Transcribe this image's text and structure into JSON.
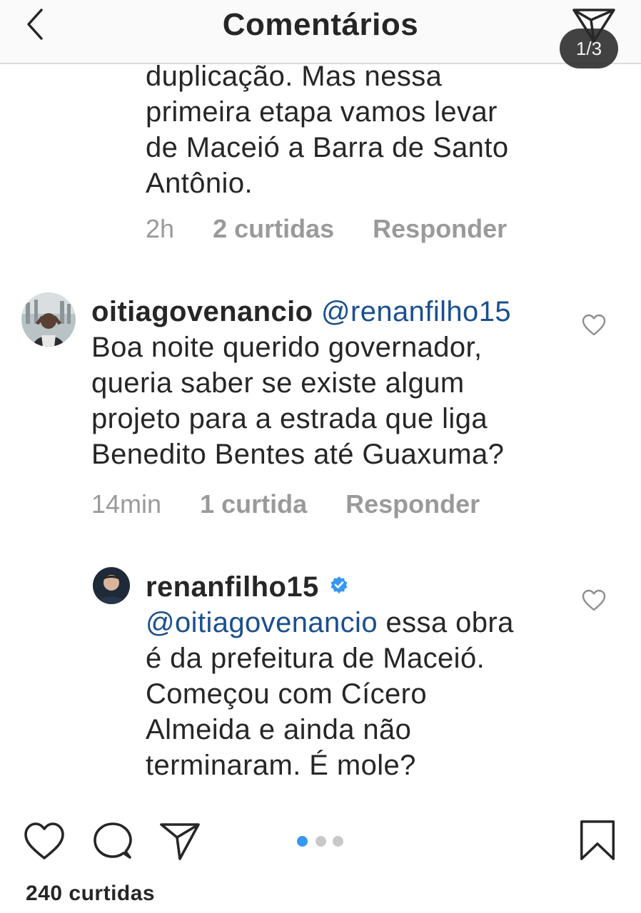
{
  "header": {
    "title": "Comentários",
    "back_icon": "chevron-left-icon",
    "direct_icon": "paper-plane-icon",
    "page_indicator": "1/3"
  },
  "comments": [
    {
      "text_lines": [
        "duplicação. Mas nessa",
        "primeira etapa vamos levar",
        "de Maceió a Barra de Santo",
        "Antônio."
      ],
      "time": "2h",
      "likes": "2 curtidas",
      "reply": "Responder"
    },
    {
      "username": "oitiagovenancio",
      "mention": "@renanfilho15",
      "text_lines": [
        "Boa noite querido governador,",
        "queria saber se existe algum",
        "projeto para a estrada que liga",
        "Benedito Bentes até Guaxuma?"
      ],
      "time": "14min",
      "likes": "1 curtida",
      "reply": "Responder"
    },
    {
      "username": "renanfilho15",
      "verified": true,
      "mention": "@oitiagovenancio",
      "text_first_suffix": " essa obra",
      "text_lines": [
        "é da prefeitura de Maceió.",
        "Começou com Cícero",
        "Almeida e ainda não",
        "terminaram. É mole?"
      ]
    }
  ],
  "actions": {
    "like_icon": "heart-icon",
    "comment_icon": "comment-bubble-icon",
    "share_icon": "paper-plane-icon",
    "save_icon": "bookmark-icon"
  },
  "carousel": {
    "total": 3,
    "active": 1
  },
  "post_likes": "240 curtidas",
  "colors": {
    "mention": "#1a4f8f",
    "verified": "#3897f0",
    "meta": "#9a9a9a",
    "active_dot": "#3897f0",
    "inactive_dot": "#c8c8c8"
  }
}
